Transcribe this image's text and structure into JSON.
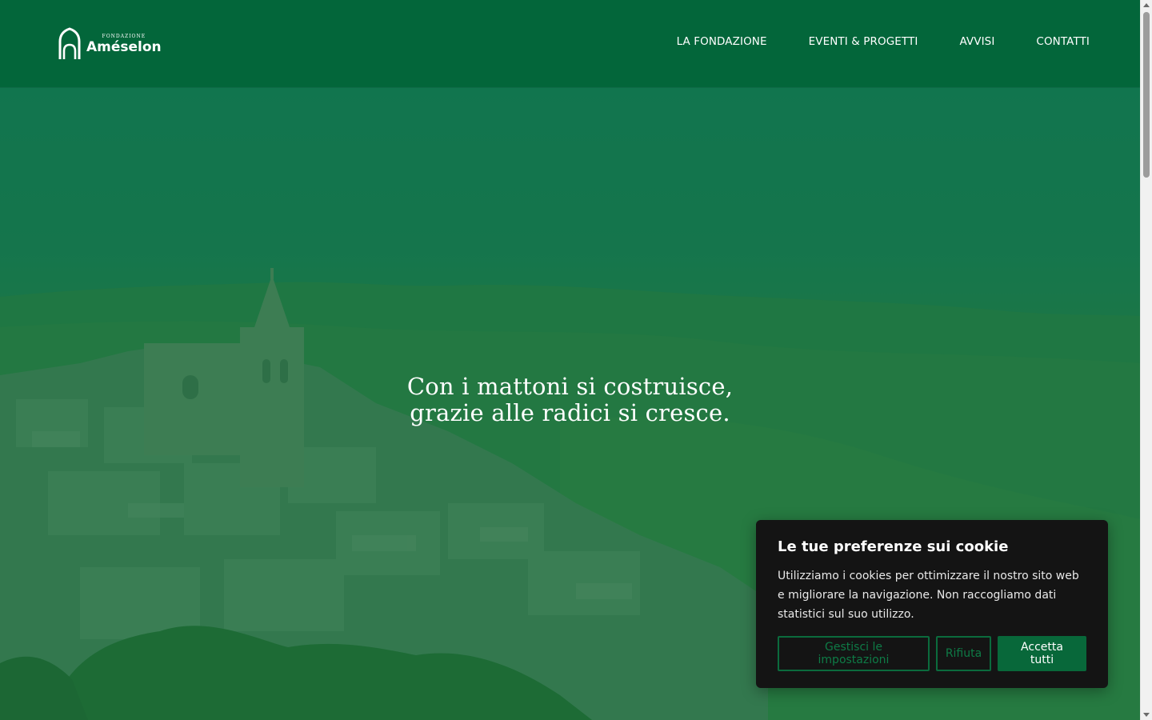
{
  "header": {
    "logo": {
      "small_text": "FONDAZIONE",
      "name": "Améselon"
    },
    "nav": [
      {
        "label": "LA FONDAZIONE"
      },
      {
        "label": "EVENTI & PROGETTI"
      },
      {
        "label": "AVVISI"
      },
      {
        "label": "CONTATTI"
      }
    ]
  },
  "hero": {
    "quote_line1": "Con i mattoni si costruisce,",
    "quote_line2": "grazie alle radici si cresce."
  },
  "cookie": {
    "title": "Le tue preferenze sui cookie",
    "text": "Utilizziamo i cookies per ottimizzare il nostro sito web e migliorare la navigazione. Non raccogliamo dati statistici sul suo utilizzo.",
    "buttons": {
      "manage": "Gestisci le impostazioni",
      "reject": "Rifiuta",
      "accept": "Accetta tutti"
    }
  },
  "colors": {
    "header_bg": "#03663a",
    "accent": "#08683a",
    "cookie_bg": "#141414"
  }
}
